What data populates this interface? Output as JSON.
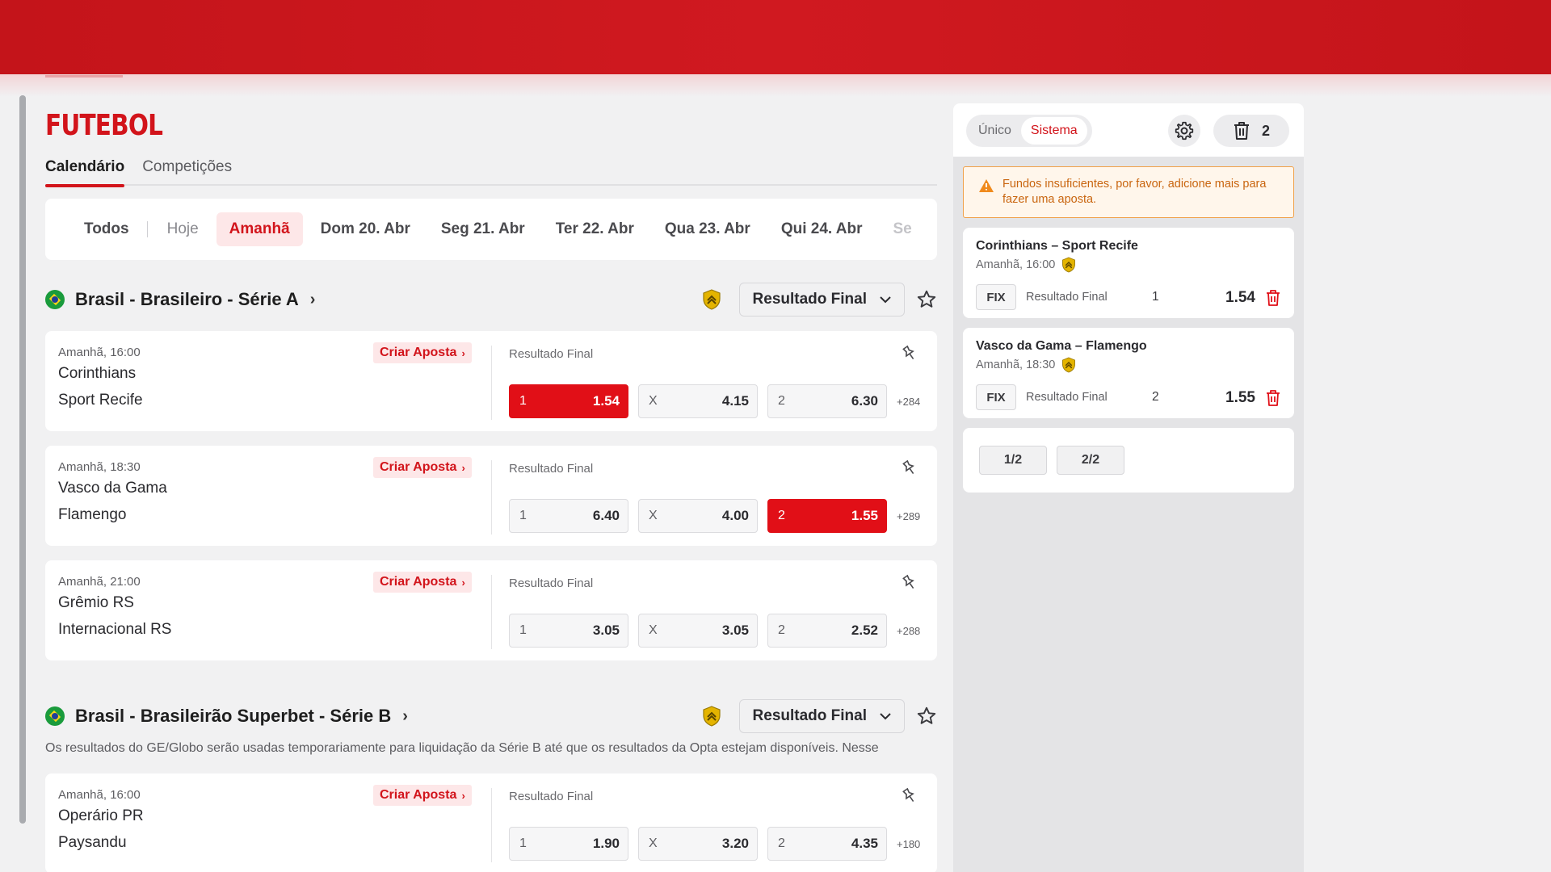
{
  "page": {
    "title": "FUTEBOL",
    "tabs": [
      {
        "label": "Calendário"
      },
      {
        "label": "Competições"
      }
    ]
  },
  "date_filter": {
    "items": [
      "Todos",
      "Hoje",
      "Amanhã",
      "Dom 20. Abr",
      "Seg 21. Abr",
      "Ter 22. Abr",
      "Qua 23. Abr",
      "Qui 24. Abr",
      "Se"
    ],
    "selected": "Amanhã"
  },
  "leagues": [
    {
      "name": "Brasil - Brasileiro - Série A",
      "market": "Resultado Final",
      "events": [
        {
          "time": "Amanhã, 16:00",
          "team1": "Corinthians",
          "team2": "Sport Recife",
          "criar": "Criar Aposta",
          "market": "Resultado Final",
          "odds": [
            {
              "label": "1",
              "value": "1.54"
            },
            {
              "label": "X",
              "value": "4.15"
            },
            {
              "label": "2",
              "value": "6.30"
            }
          ],
          "more": "+284"
        },
        {
          "time": "Amanhã, 18:30",
          "team1": "Vasco da Gama",
          "team2": "Flamengo",
          "criar": "Criar Aposta",
          "market": "Resultado Final",
          "odds": [
            {
              "label": "1",
              "value": "6.40"
            },
            {
              "label": "X",
              "value": "4.00"
            },
            {
              "label": "2",
              "value": "1.55"
            }
          ],
          "more": "+289"
        },
        {
          "time": "Amanhã, 21:00",
          "team1": "Grêmio RS",
          "team2": "Internacional RS",
          "criar": "Criar Aposta",
          "market": "Resultado Final",
          "odds": [
            {
              "label": "1",
              "value": "3.05"
            },
            {
              "label": "X",
              "value": "3.05"
            },
            {
              "label": "2",
              "value": "2.52"
            }
          ],
          "more": "+288"
        }
      ]
    },
    {
      "name": "Brasil - Brasileirão Superbet - Série B",
      "market": "Resultado Final",
      "notice": "Os resultados do GE/Globo serão usadas temporariamente para liquidação da Série B até que os resultados da Opta estejam disponíveis. Nesse",
      "events": [
        {
          "time": "Amanhã, 16:00",
          "team1": "Operário PR",
          "team2": "Paysandu",
          "criar": "Criar Aposta",
          "market": "Resultado Final",
          "odds": [
            {
              "label": "1",
              "value": "1.90"
            },
            {
              "label": "X",
              "value": "3.20"
            },
            {
              "label": "2",
              "value": "4.35"
            }
          ],
          "more": "+180"
        }
      ]
    }
  ],
  "betslip": {
    "modes": [
      "Único",
      "Sistema"
    ],
    "active_mode": "Sistema",
    "count": "2",
    "warning": "Fundos insuficientes, por favor, adicione mais para fazer uma aposta.",
    "selections": [
      {
        "match": "Corinthians – Sport Recife",
        "time": "Amanhã, 16:00",
        "fix": "FIX",
        "market": "Resultado Final",
        "pick": "1",
        "odd": "1.54"
      },
      {
        "match": "Vasco da Gama – Flamengo",
        "time": "Amanhã, 18:30",
        "fix": "FIX",
        "market": "Resultado Final",
        "pick": "2",
        "odd": "1.55"
      }
    ],
    "systems": [
      "1/2",
      "2/2"
    ]
  },
  "colors": {
    "brand_red": "#d2141b",
    "selected_odd": "#e10f17",
    "warning_orange": "#f0a14a",
    "shield_gold": "#e4b400"
  }
}
